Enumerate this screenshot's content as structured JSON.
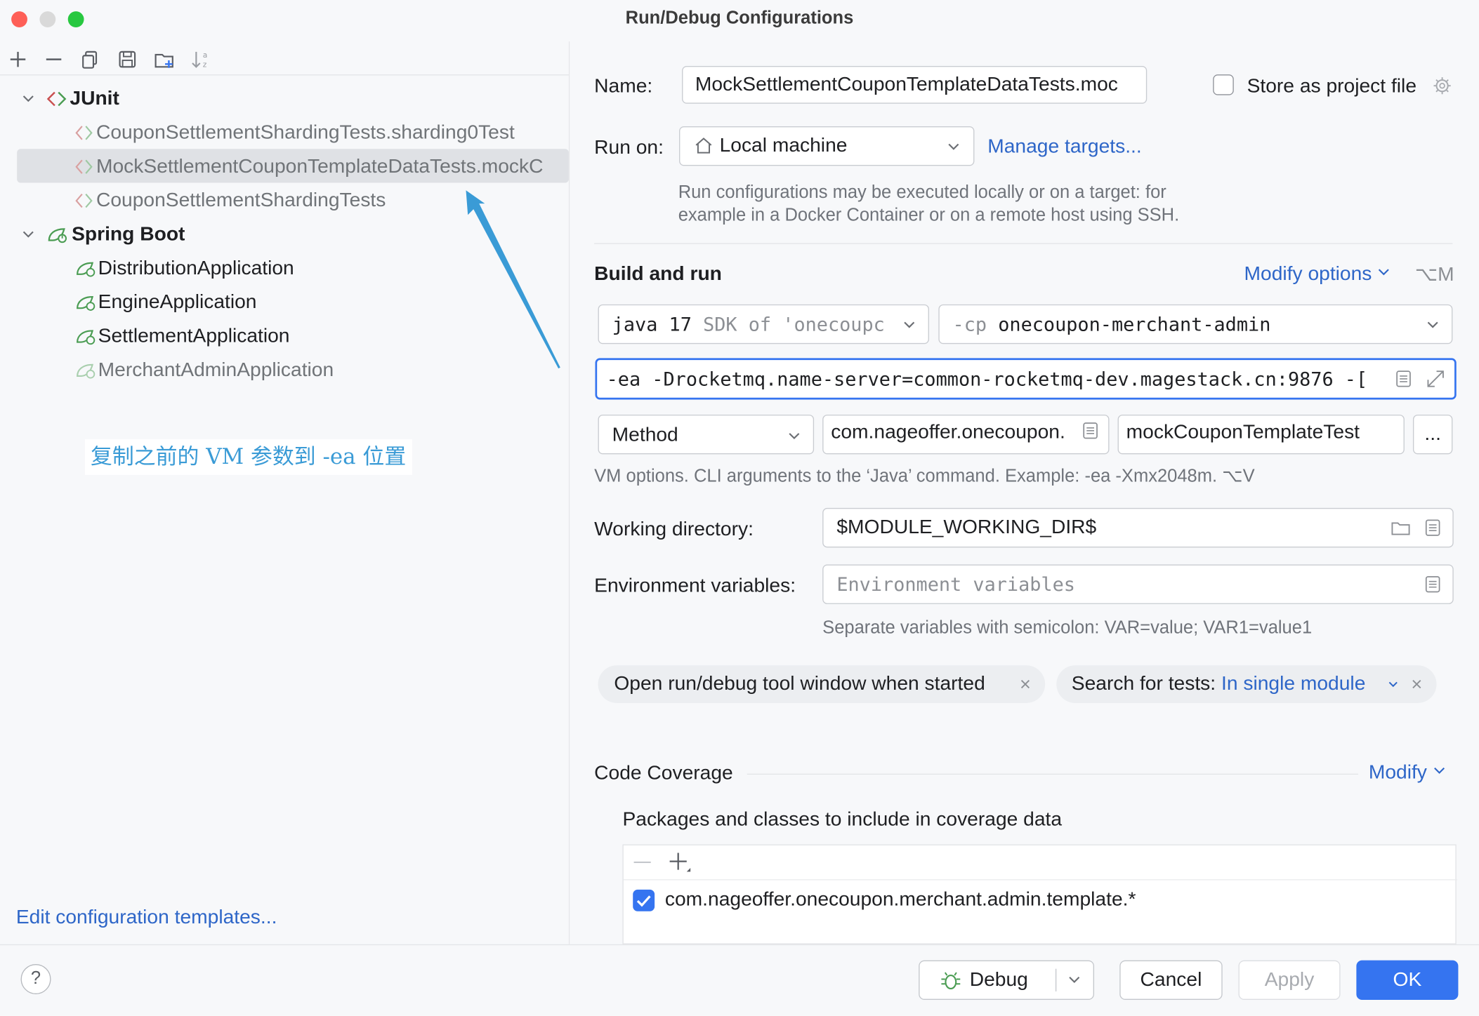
{
  "window": {
    "title": "Run/Debug Configurations"
  },
  "colors": {
    "accent": "#3574f0",
    "link": "#2e66c8",
    "annotation": "#3a9bd6",
    "selection": "#dfe1e5"
  },
  "toolbar": {
    "icons": [
      "add-icon",
      "remove-icon",
      "copy-icon",
      "save-icon",
      "new-folder-icon",
      "sort-icon"
    ]
  },
  "tree": {
    "groups": [
      {
        "label": "JUnit",
        "items": [
          "CouponSettlementShardingTests.sharding0Test",
          "MockSettlementCouponTemplateDataTests.mockC",
          "CouponSettlementShardingTests"
        ]
      },
      {
        "label": "Spring Boot",
        "items": [
          "DistributionApplication",
          "EngineApplication",
          "SettlementApplication",
          "MerchantAdminApplication"
        ]
      }
    ]
  },
  "annotation": {
    "text": "复制之前的 VM 参数到 -ea 位置"
  },
  "left_footer": {
    "link": "Edit configuration templates..."
  },
  "form": {
    "name_label": "Name:",
    "name_value": "MockSettlementCouponTemplateDataTests.moc",
    "store_label": "Store as project file",
    "run_on_label": "Run on:",
    "run_on_value": "Local machine",
    "manage_targets": "Manage targets...",
    "run_on_hint_1": "Run configurations may be executed locally or on a target: for",
    "run_on_hint_2": "example in a Docker Container or on a remote host using SSH.",
    "build_run_title": "Build and run",
    "modify_options": "Modify options",
    "modify_shortcut": "⌥M",
    "sdk_main": "java 17",
    "sdk_suffix": "SDK of 'onecoupc",
    "cp_prefix": "-cp",
    "cp_value": "onecoupon-merchant-admin",
    "vm_options": "-ea -Drocketmq.name-server=common-rocketmq-dev.magestack.cn:9876 -[",
    "test_kind": "Method",
    "class_value": "com.nageoffer.onecoupon.",
    "method_value": "mockCouponTemplateTest",
    "more_button": "...",
    "vm_hint": "VM options. CLI arguments to the ‘Java’ command. Example: -ea -Xmx2048m. ⌥V",
    "workdir_label": "Working directory:",
    "workdir_value": "$MODULE_WORKING_DIR$",
    "env_label": "Environment variables:",
    "env_placeholder": "Environment variables",
    "env_hint": "Separate variables with semicolon: VAR=value; VAR1=value1",
    "chip1": "Open run/debug tool window when started",
    "chip2_label": "Search for tests:",
    "chip2_value": "In single module",
    "coverage_title": "Code Coverage",
    "coverage_modify": "Modify",
    "coverage_sub": "Packages and classes to include in coverage data",
    "coverage_item": "com.nageoffer.onecoupon.merchant.admin.template.*"
  },
  "footer": {
    "help": "?",
    "debug": "Debug",
    "cancel": "Cancel",
    "apply": "Apply",
    "ok": "OK"
  }
}
